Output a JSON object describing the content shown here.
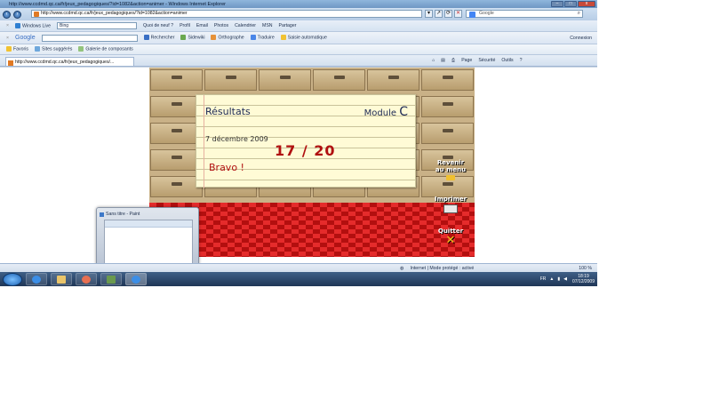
{
  "window": {
    "title": "http://www.ccdmd.qc.ca/fr/jeux_pedagogiques/?id=1082&action=animer - Windows Internet Explorer"
  },
  "address_bar": {
    "url": "http://www.ccdmd.qc.ca/fr/jeux_pedagogiques/?id=1082&action=animer",
    "search_placeholder": "Google"
  },
  "windows_live_bar": {
    "brand": "Windows Live",
    "search_value": "Bing",
    "items": [
      "Quoi de neuf ?",
      "Profil",
      "Email",
      "Photos",
      "Calendrier",
      "MSN",
      "Partager"
    ]
  },
  "google_bar": {
    "brand": "Google",
    "items": [
      "Rechercher",
      "Sidewiki",
      "Orthographe",
      "Traduire",
      "Saisie automatique"
    ],
    "connexion": "Connexion"
  },
  "favorites_bar": {
    "favorites": "Favoris",
    "items": [
      "Sites suggérés",
      "Galerie de composants"
    ]
  },
  "tab": {
    "label": "http://www.ccdmd.qc.ca/fr/jeux_pedagogiques/...",
    "commands": [
      "Page",
      "Sécurité",
      "Outils"
    ]
  },
  "results": {
    "title": "Résultats",
    "module_label": "Module",
    "module_value": "C",
    "date": "7 décembre 2009",
    "score": "17 / 20",
    "message": "Bravo !"
  },
  "side_buttons": {
    "back": [
      "Revenir",
      "au menu"
    ],
    "print": "Imprimer",
    "quit": "Quitter"
  },
  "thumbnail": {
    "title": "Sans titre - Paint"
  },
  "status_bar": {
    "zone": "Internet | Mode protégé : activé",
    "zoom": "100 %"
  },
  "taskbar": {
    "language": "FR",
    "time": "18:19",
    "date": "07/12/2009"
  }
}
